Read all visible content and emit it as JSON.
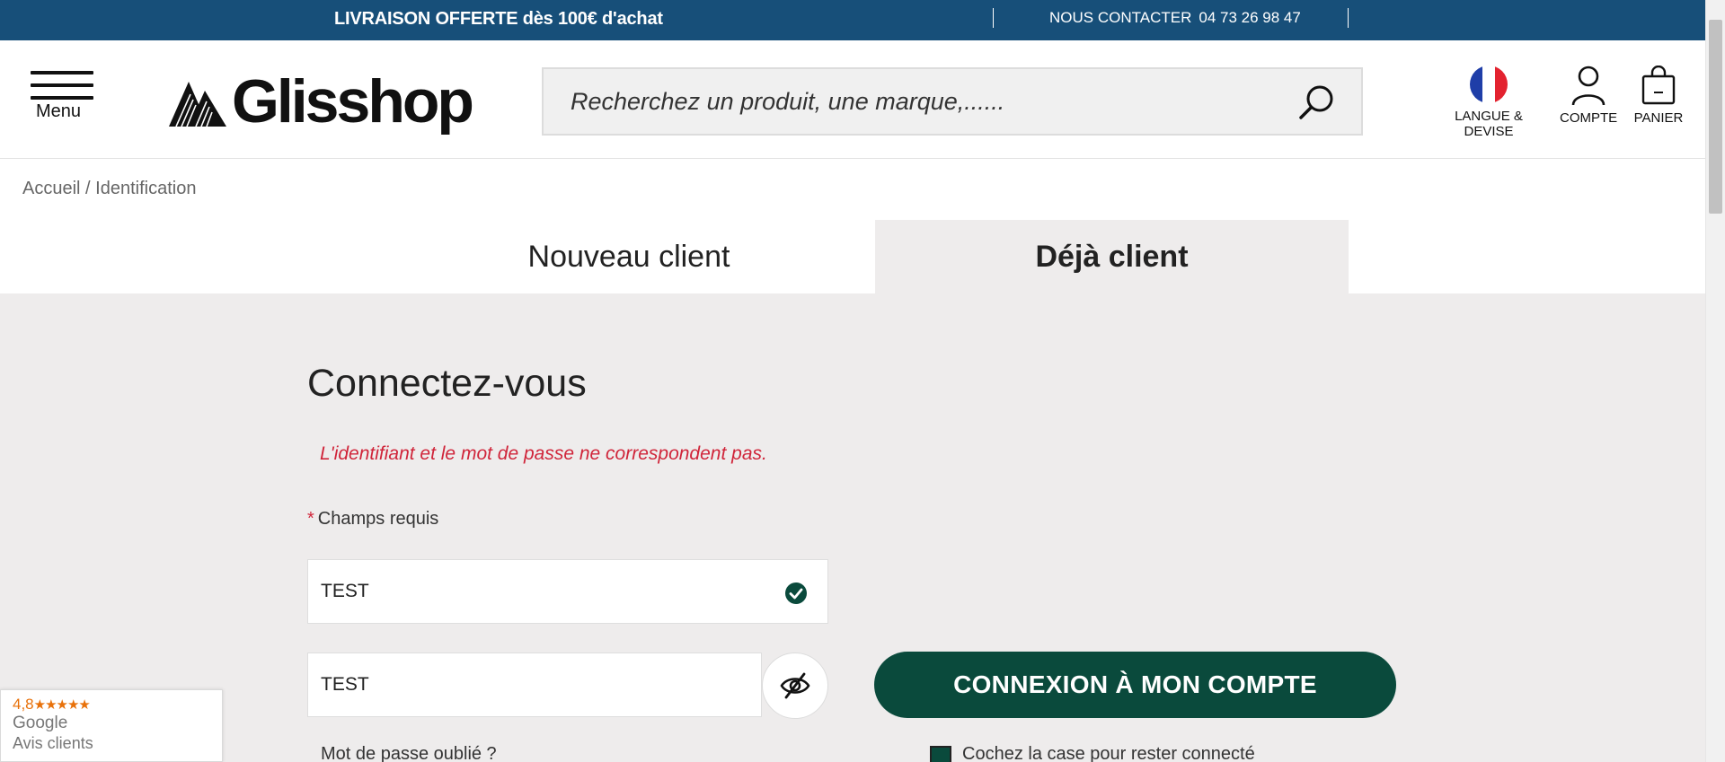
{
  "topbar": {
    "promo": "LIVRAISON OFFERTE dès 100€ d'achat",
    "contact_label": "NOUS CONTACTER",
    "phone": "04 73 26 98 47",
    "bg_color": "#174f79"
  },
  "header": {
    "menu_label": "Menu",
    "logo_text": "Glisshop",
    "search_placeholder": "Recherchez un produit, une marque,......",
    "language_label": "LANGUE & DEVISE",
    "account_label": "COMPTE",
    "cart_label": "PANIER",
    "icons": [
      "menu-icon",
      "search-icon",
      "france-flag-icon",
      "user-icon",
      "bag-icon"
    ]
  },
  "breadcrumb": {
    "home": "Accueil",
    "separator": " / ",
    "current": "Identification"
  },
  "tabs": {
    "new_client": "Nouveau client",
    "existing_client": "Déjà client",
    "active": "existing_client"
  },
  "login": {
    "title": "Connectez-vous",
    "error": "L'identifiant et le mot de passe ne correspondent pas.",
    "required_star": "*",
    "required_label": "Champs requis",
    "username_value": "TEST",
    "password_value": "TEST",
    "submit_label": "CONNEXION À MON COMPTE",
    "forgot_label": "Mot de passe oublié ?",
    "remember_label": "Cochez la case pour rester connecté",
    "accent_color": "#0a4a3c",
    "error_color": "#d0253a"
  },
  "reviews": {
    "score": "4,8",
    "stars": "★★★★★",
    "source": "Google",
    "label": "Avis clients",
    "color": "#e8710a"
  }
}
